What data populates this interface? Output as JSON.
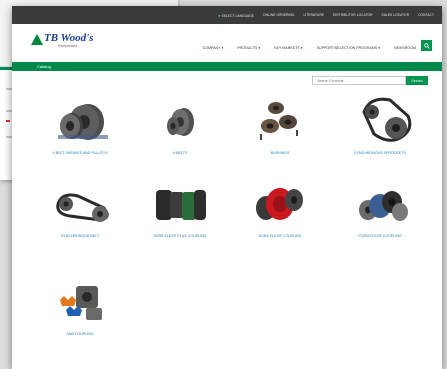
{
  "utility_bar": {
    "links": [
      "SELECT LANGUAGE",
      "ONLINE ORDERING",
      "LITERATURE",
      "DISTRIBUTOR LOCATOR",
      "SALES LOCATOR",
      "CONTACT"
    ]
  },
  "logo": {
    "name": "TB Wood's",
    "sub": "Incorporated"
  },
  "nav": {
    "items": [
      "COMPANY",
      "PRODUCTS",
      "KEY MARKETS",
      "SUPPORT/SELECTION PROGRAMS",
      "NEWSROOM"
    ]
  },
  "breadcrumb": "Catalog",
  "search": {
    "placeholder": "Search Products...",
    "button": "Search"
  },
  "products": [
    "V-BELT SHEAVES AND PULLEYS",
    "V-BELTS",
    "BUSHINGS",
    "SYNCHRONOUS SPROCKETS",
    "SYNCHRONOUS BELT",
    "SURE-FLEX® PLUS COUPLING",
    "DURA-FLEX® COUPLING",
    "FORM-FLEX® COUPLING",
    "JAW COUPLING"
  ],
  "colors": {
    "brand_green": "#00954f",
    "link_blue": "#1e7bb8",
    "logo_blue": "#1b3f8f"
  }
}
